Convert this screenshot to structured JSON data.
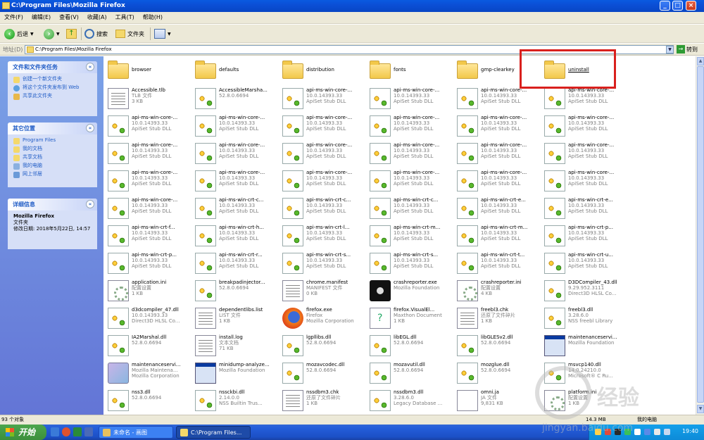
{
  "window": {
    "title": "C:\\Program Files\\Mozilla Firefox",
    "min": "_",
    "max": "□",
    "close": "×"
  },
  "menu": [
    "文件(F)",
    "编辑(E)",
    "查看(V)",
    "收藏(A)",
    "工具(T)",
    "帮助(H)"
  ],
  "toolbar": {
    "back": "后退",
    "search": "搜索",
    "folders": "文件夹"
  },
  "address": {
    "label": "地址(D)",
    "value": "C:\\Program Files\\Mozilla Firefox",
    "go": "转到"
  },
  "left_pane": {
    "tasks_header": "文件和文件夹任务",
    "tasks": [
      "创建一个新文件夹",
      "将这个文件夹发布到 Web",
      "共享此文件夹"
    ],
    "places_header": "其它位置",
    "places": [
      "Program Files",
      "我的文档",
      "共享文档",
      "我的电脑",
      "网上邻居"
    ],
    "details_header": "详细信息",
    "details_name": "Mozilla Firefox",
    "details_type": "文件夹",
    "details_modified": "修改日期: 2018年5月22日, 14:57"
  },
  "files": [
    {
      "icon": "folder",
      "name": "browser"
    },
    {
      "icon": "folder",
      "name": "defaults"
    },
    {
      "icon": "folder",
      "name": "distribution"
    },
    {
      "icon": "folder",
      "name": "fonts"
    },
    {
      "icon": "folder",
      "name": "gmp-clearkey"
    },
    {
      "icon": "folder",
      "name": "uninstall"
    },
    {
      "icon": "doc",
      "name": "Accessible.tlb",
      "l2": "TLB 文件",
      "l3": "3 KB"
    },
    {
      "icon": "dll",
      "name": "AccessibleMarsha...",
      "l2": "52.8.0.6694",
      "l3": ""
    },
    {
      "icon": "dll",
      "name": "api-ms-win-core-...",
      "l2": "10.0.14393.33",
      "l3": "ApiSet Stub DLL"
    },
    {
      "icon": "dll",
      "name": "api-ms-win-core-...",
      "l2": "10.0.14393.33",
      "l3": "ApiSet Stub DLL"
    },
    {
      "icon": "dll",
      "name": "api-ms-win-core-...",
      "l2": "10.0.14393.33",
      "l3": "ApiSet Stub DLL"
    },
    {
      "icon": "dll",
      "name": "api-ms-win-core-...",
      "l2": "10.0.14393.33",
      "l3": "ApiSet Stub DLL"
    },
    {
      "icon": "dll",
      "name": "api-ms-win-core-...",
      "l2": "10.0.14393.33",
      "l3": "ApiSet Stub DLL"
    },
    {
      "icon": "dll",
      "name": "api-ms-win-core-...",
      "l2": "10.0.14393.33",
      "l3": "ApiSet Stub DLL"
    },
    {
      "icon": "dll",
      "name": "api-ms-win-core-...",
      "l2": "10.0.14393.33",
      "l3": "ApiSet Stub DLL"
    },
    {
      "icon": "dll",
      "name": "api-ms-win-core-...",
      "l2": "10.0.14393.33",
      "l3": "ApiSet Stub DLL"
    },
    {
      "icon": "dll",
      "name": "api-ms-win-core-...",
      "l2": "10.0.14393.33",
      "l3": "ApiSet Stub DLL"
    },
    {
      "icon": "dll",
      "name": "api-ms-win-core-...",
      "l2": "10.0.14393.33",
      "l3": "ApiSet Stub DLL"
    },
    {
      "icon": "dll",
      "name": "api-ms-win-core-...",
      "l2": "10.0.14393.33",
      "l3": "ApiSet Stub DLL"
    },
    {
      "icon": "dll",
      "name": "api-ms-win-core-...",
      "l2": "10.0.14393.33",
      "l3": "ApiSet Stub DLL"
    },
    {
      "icon": "dll",
      "name": "api-ms-win-core-...",
      "l2": "10.0.14393.33",
      "l3": "ApiSet Stub DLL"
    },
    {
      "icon": "dll",
      "name": "api-ms-win-core-...",
      "l2": "10.0.14393.33",
      "l3": "ApiSet Stub DLL"
    },
    {
      "icon": "dll",
      "name": "api-ms-win-core-...",
      "l2": "10.0.14393.33",
      "l3": "ApiSet Stub DLL"
    },
    {
      "icon": "dll",
      "name": "api-ms-win-core-...",
      "l2": "10.0.14393.33",
      "l3": "ApiSet Stub DLL"
    },
    {
      "icon": "dll",
      "name": "api-ms-win-core-...",
      "l2": "10.0.14393.33",
      "l3": "ApiSet Stub DLL"
    },
    {
      "icon": "dll",
      "name": "api-ms-win-core-...",
      "l2": "10.0.14393.33",
      "l3": "ApiSet Stub DLL"
    },
    {
      "icon": "dll",
      "name": "api-ms-win-core-...",
      "l2": "10.0.14393.33",
      "l3": "ApiSet Stub DLL"
    },
    {
      "icon": "dll",
      "name": "api-ms-win-core-...",
      "l2": "10.0.14393.33",
      "l3": "ApiSet Stub DLL"
    },
    {
      "icon": "dll",
      "name": "api-ms-win-core-...",
      "l2": "10.0.14393.33",
      "l3": "ApiSet Stub DLL"
    },
    {
      "icon": "dll",
      "name": "api-ms-win-core-...",
      "l2": "10.0.14393.33",
      "l3": "ApiSet Stub DLL"
    },
    {
      "icon": "dll",
      "name": "api-ms-win-core-...",
      "l2": "10.0.14393.33",
      "l3": "ApiSet Stub DLL"
    },
    {
      "icon": "dll",
      "name": "api-ms-win-crt-c...",
      "l2": "10.0.14393.33",
      "l3": "ApiSet Stub DLL"
    },
    {
      "icon": "dll",
      "name": "api-ms-win-crt-c...",
      "l2": "10.0.14393.33",
      "l3": "ApiSet Stub DLL"
    },
    {
      "icon": "dll",
      "name": "api-ms-win-crt-c...",
      "l2": "10.0.14393.33",
      "l3": "ApiSet Stub DLL"
    },
    {
      "icon": "dll",
      "name": "api-ms-win-crt-e...",
      "l2": "10.0.14393.33",
      "l3": "ApiSet Stub DLL"
    },
    {
      "icon": "dll",
      "name": "api-ms-win-crt-e...",
      "l2": "10.0.14393.33",
      "l3": "ApiSet Stub DLL"
    },
    {
      "icon": "dll",
      "name": "api-ms-win-crt-f...",
      "l2": "10.0.14393.33",
      "l3": "ApiSet Stub DLL"
    },
    {
      "icon": "dll",
      "name": "api-ms-win-crt-h...",
      "l2": "10.0.14393.33",
      "l3": "ApiSet Stub DLL"
    },
    {
      "icon": "dll",
      "name": "api-ms-win-crt-l...",
      "l2": "10.0.14393.33",
      "l3": "ApiSet Stub DLL"
    },
    {
      "icon": "dll",
      "name": "api-ms-win-crt-m...",
      "l2": "10.0.14393.33",
      "l3": "ApiSet Stub DLL"
    },
    {
      "icon": "dll",
      "name": "api-ms-win-crt-m...",
      "l2": "10.0.14393.33",
      "l3": "ApiSet Stub DLL"
    },
    {
      "icon": "dll",
      "name": "api-ms-win-crt-p...",
      "l2": "10.0.14393.33",
      "l3": "ApiSet Stub DLL"
    },
    {
      "icon": "dll",
      "name": "api-ms-win-crt-p...",
      "l2": "10.0.14393.33",
      "l3": "ApiSet Stub DLL"
    },
    {
      "icon": "dll",
      "name": "api-ms-win-crt-r...",
      "l2": "10.0.14393.33",
      "l3": "ApiSet Stub DLL"
    },
    {
      "icon": "dll",
      "name": "api-ms-win-crt-s...",
      "l2": "10.0.14393.33",
      "l3": "ApiSet Stub DLL"
    },
    {
      "icon": "dll",
      "name": "api-ms-win-crt-s...",
      "l2": "10.0.14393.33",
      "l3": "ApiSet Stub DLL"
    },
    {
      "icon": "dll",
      "name": "api-ms-win-crt-t...",
      "l2": "10.0.14393.33",
      "l3": "ApiSet Stub DLL"
    },
    {
      "icon": "dll",
      "name": "api-ms-win-crt-u...",
      "l2": "10.0.14393.33",
      "l3": "ApiSet Stub DLL"
    },
    {
      "icon": "ini",
      "name": "application.ini",
      "l2": "配置设置",
      "l3": "1 KB"
    },
    {
      "icon": "dll",
      "name": "breakpadinjector...",
      "l2": "52.8.0.6694",
      "l3": ""
    },
    {
      "icon": "doc",
      "name": "chrome.manifest",
      "l2": "MANIFEST 文件",
      "l3": "0 KB"
    },
    {
      "icon": "crash",
      "name": "crashreporter.exe",
      "l2": "Mozilla Foundation",
      "l3": ""
    },
    {
      "icon": "ini",
      "name": "crashreporter.ini",
      "l2": "配置设置",
      "l3": "4 KB"
    },
    {
      "icon": "dll",
      "name": "D3DCompiler_43.dll",
      "l2": "9.29.952.3111",
      "l3": "Direct3D HLSL Co..."
    },
    {
      "icon": "dll",
      "name": "d3dcompiler_47.dll",
      "l2": "10.0.14393.33",
      "l3": "Direct3D HLSL Co..."
    },
    {
      "icon": "doc",
      "name": "dependentlibs.list",
      "l2": "LIST 文件",
      "l3": "1 KB"
    },
    {
      "icon": "ff",
      "name": "firefox.exe",
      "l2": "Firefox",
      "l3": "Mozilla Corporation"
    },
    {
      "icon": "help",
      "name": "firefox.VisualEl...",
      "l2": "Maxthon Document",
      "l3": "1 KB"
    },
    {
      "icon": "doc",
      "name": "freebl3.chk",
      "l2": "还原了文件碎片",
      "l3": "1 KB"
    },
    {
      "icon": "dll",
      "name": "freebl3.dll",
      "l2": "3.28.6.0",
      "l3": "NSS freebl Library"
    },
    {
      "icon": "dll",
      "name": "IA2Marshal.dll",
      "l2": "52.8.0.6694",
      "l3": ""
    },
    {
      "icon": "doc",
      "name": "install.log",
      "l2": "文本文档",
      "l3": "71 KB"
    },
    {
      "icon": "dll",
      "name": "lgpllibs.dll",
      "l2": "52.8.0.6694",
      "l3": ""
    },
    {
      "icon": "dll",
      "name": "libEGL.dll",
      "l2": "52.8.0.6694",
      "l3": ""
    },
    {
      "icon": "dll",
      "name": "libGLESv2.dll",
      "l2": "52.8.0.6694",
      "l3": ""
    },
    {
      "icon": "exe",
      "name": "maintenanceservi...",
      "l2": "Mozilla Foundation",
      "l3": ""
    },
    {
      "icon": "msi",
      "name": "maintenanceservi...",
      "l2": "Mozilla Maintena...",
      "l3": "Mozilla Corporation"
    },
    {
      "icon": "exe",
      "name": "minidump-analyze...",
      "l2": "Mozilla Foundation",
      "l3": ""
    },
    {
      "icon": "dll",
      "name": "mozavcodec.dll",
      "l2": "52.8.0.6694",
      "l3": ""
    },
    {
      "icon": "dll",
      "name": "mozavutil.dll",
      "l2": "52.8.0.6694",
      "l3": ""
    },
    {
      "icon": "dll",
      "name": "mozglue.dll",
      "l2": "52.8.0.6694",
      "l3": ""
    },
    {
      "icon": "dll",
      "name": "msvcp140.dll",
      "l2": "14.0.24210.0",
      "l3": "Microsoft® C Ru..."
    },
    {
      "icon": "dll",
      "name": "nss3.dll",
      "l2": "52.8.0.6694",
      "l3": ""
    },
    {
      "icon": "dll",
      "name": "nssckbi.dll",
      "l2": "2.14.0.0",
      "l3": "NSS Builtin Trus..."
    },
    {
      "icon": "doc",
      "name": "nssdbm3.chk",
      "l2": "还原了文件碎片",
      "l3": "1 KB"
    },
    {
      "icon": "dll",
      "name": "nssdbm3.dll",
      "l2": "3.28.6.0",
      "l3": "Legacy Database ..."
    },
    {
      "icon": "ja",
      "name": "omni.ja",
      "l2": "JA 文件",
      "l3": "9,831 KB"
    },
    {
      "icon": "ini",
      "name": "platform.ini",
      "l2": "配置设置",
      "l3": "1 KB"
    }
  ],
  "status": {
    "count": "93 个对象",
    "size": "14.3 MB",
    "location": "我的电脑"
  },
  "taskbar": {
    "start": "开始",
    "tasks": [
      "未命名 - 画图",
      "C:\\Program Files..."
    ],
    "clock": "19:40"
  },
  "watermark": {
    "text": "经验",
    "url": "jingyan.baidu.com"
  },
  "colors": {
    "title_blue": "#0b4fd6",
    "highlight_red": "#d9201d",
    "taskbar_blue": "#245edb",
    "start_green": "#3c8f3c"
  }
}
